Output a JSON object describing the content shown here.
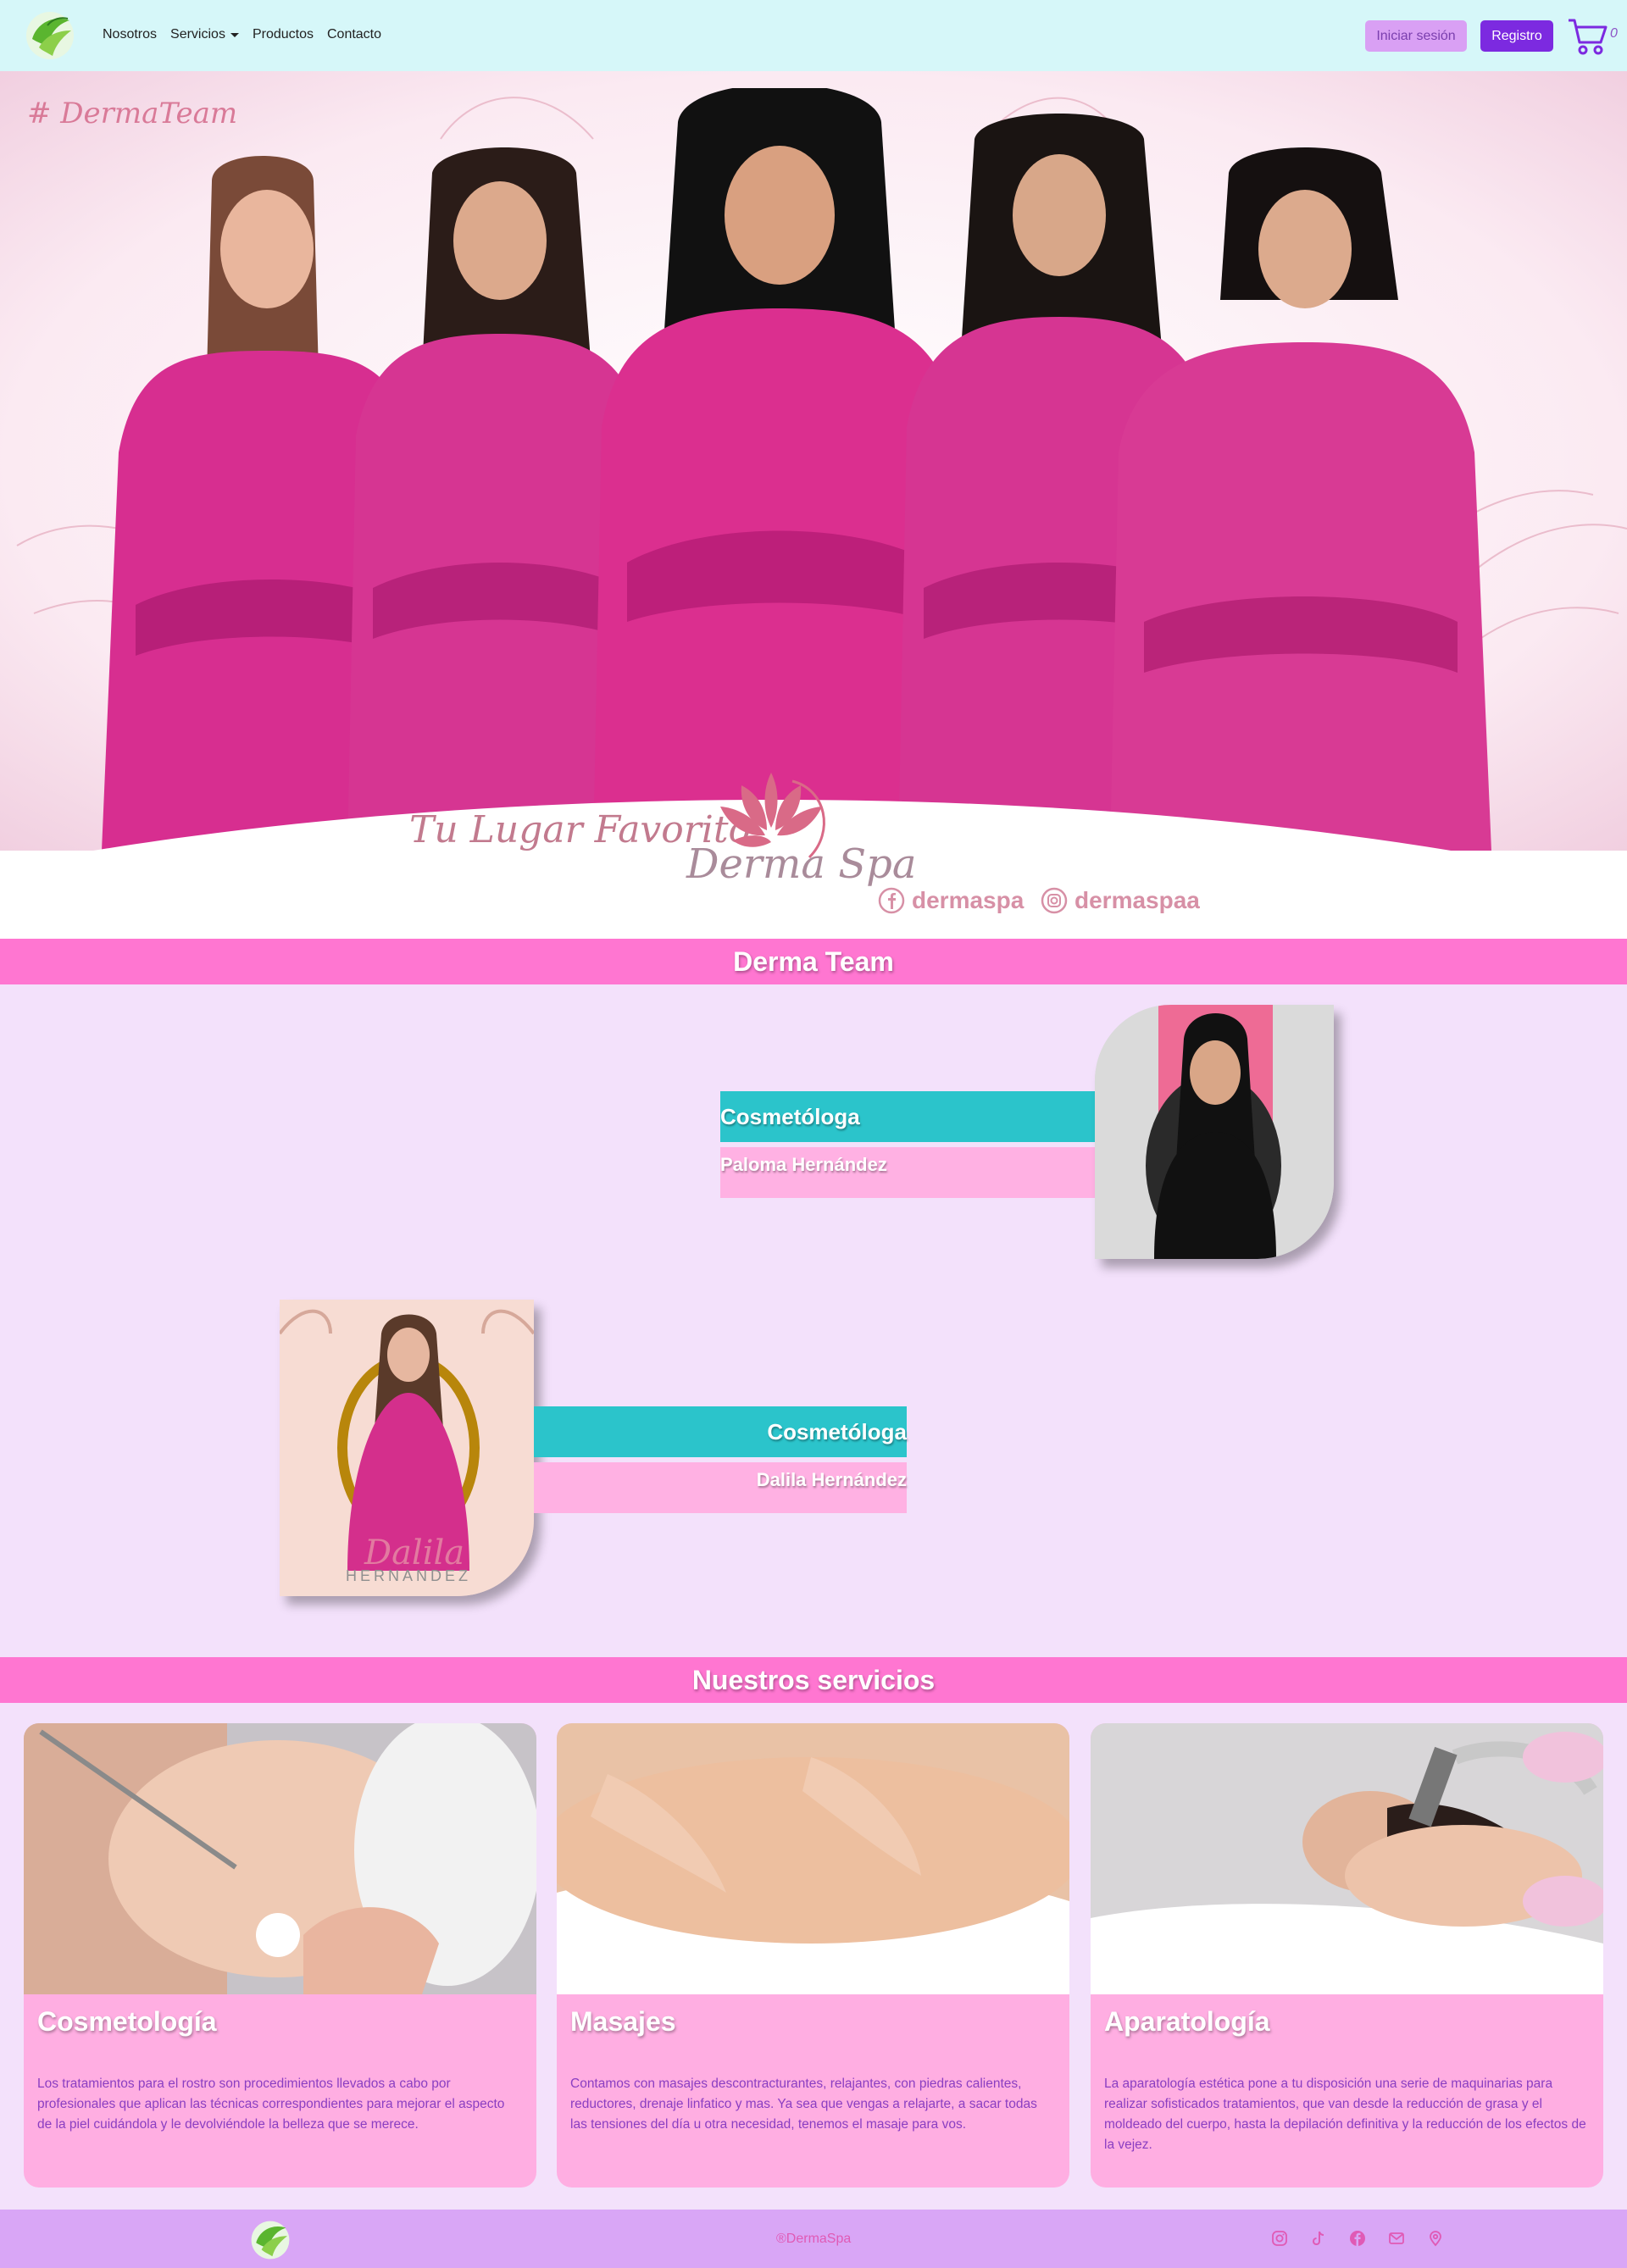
{
  "navbar": {
    "links": [
      {
        "label": "Nosotros"
      },
      {
        "label": "Servicios",
        "dropdown": true
      },
      {
        "label": "Productos"
      },
      {
        "label": "Contacto"
      }
    ],
    "login_label": "Iniciar sesión",
    "register_label": "Registro",
    "cart_count": "0"
  },
  "hero": {
    "hashtag": "# DermaTeam",
    "tagline": "Tu Lugar Favorito",
    "brand_name": "Derma Spa",
    "facebook_handle": "dermaspa",
    "instagram_handle": "dermaspaa"
  },
  "team": {
    "title": "Derma Team",
    "members": [
      {
        "role": "Cosmetóloga",
        "name": "Paloma Hernández"
      },
      {
        "role": "Cosmetóloga",
        "name": "Dalila Hernández",
        "portrait_script": "Dalila",
        "portrait_caption": "HERNANDEZ"
      }
    ]
  },
  "services": {
    "title": "Nuestros servicios",
    "cards": [
      {
        "title": "Cosmetología",
        "text": "Los tratamientos para el rostro son procedimientos llevados a cabo por profesionales que aplican las técnicas correspondientes para mejorar el aspecto de la piel cuidándola y le devolviéndole la belleza que se merece."
      },
      {
        "title": "Masajes",
        "text": "Contamos con masajes descontracturantes, relajantes, con piedras calientes, reductores, drenaje linfatico y mas. Ya sea que vengas a relajarte, a sacar todas las tensiones del día u otra necesidad, tenemos el masaje para vos."
      },
      {
        "title": "Aparatología",
        "text": "La aparatología estética pone a tu disposición una serie de maquinarias para realizar sofisticados tratamientos, que van desde la reducción de grasa y el moldeado del cuerpo, hasta la depilación definitiva y la reducción de los efectos de la vejez."
      }
    ]
  },
  "footer": {
    "copyright": "®DermaSpa",
    "icons": [
      "instagram-icon",
      "tiktok-icon",
      "facebook-icon",
      "mail-icon",
      "location-icon"
    ]
  },
  "colors": {
    "navbar_bg": "#d6f7f9",
    "accent_pink": "#ff76d1",
    "teal": "#2bc4cb",
    "light_pink": "#ffb1e3",
    "lavender_bg": "#f3e1fb",
    "purple": "#7c2ae0",
    "footer_bg": "#d9a6f6"
  }
}
